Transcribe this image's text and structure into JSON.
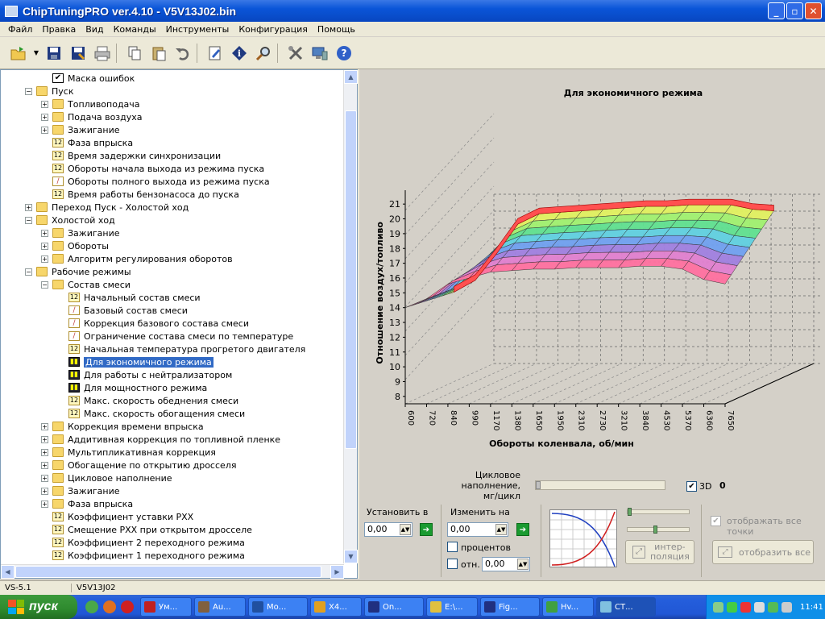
{
  "window": {
    "title": "ChipTuningPRO ver.4.10 - V5V13J02.bin"
  },
  "menu": [
    "Файл",
    "Правка",
    "Вид",
    "Команды",
    "Инструменты",
    "Конфигурация",
    "Помощь"
  ],
  "toolbar": {
    "icons": [
      "open-icon",
      "dropdown-arrow-icon",
      "save-icon",
      "save-as-icon",
      "print-icon",
      "copy-icon",
      "paste-icon",
      "undo-icon",
      "edit-icon",
      "info-icon",
      "search-icon",
      "tools-icon",
      "connect-icon",
      "help-icon"
    ]
  },
  "tree": [
    {
      "level": 2,
      "type": "check",
      "exp": "",
      "label": "Маска ошибок"
    },
    {
      "level": 1,
      "type": "folder",
      "exp": "-",
      "label": "Пуск"
    },
    {
      "level": 2,
      "type": "folder",
      "exp": "+",
      "label": "Топливоподача"
    },
    {
      "level": 2,
      "type": "folder",
      "exp": "+",
      "label": "Подача воздуха"
    },
    {
      "level": 2,
      "type": "folder",
      "exp": "+",
      "label": "Зажигание"
    },
    {
      "level": 2,
      "type": "num",
      "exp": "",
      "label": "Фаза впрыска"
    },
    {
      "level": 2,
      "type": "num",
      "exp": "",
      "label": "Время задержки синхронизации"
    },
    {
      "level": 2,
      "type": "num",
      "exp": "",
      "label": "Обороты начала выхода из режима пуска"
    },
    {
      "level": 2,
      "type": "curve",
      "exp": "",
      "label": "Обороты полного выхода из режима пуска"
    },
    {
      "level": 2,
      "type": "num",
      "exp": "",
      "label": "Время работы бензонасоса до пуска"
    },
    {
      "level": 1,
      "type": "folder",
      "exp": "+",
      "label": "Переход Пуск - Холостой ход"
    },
    {
      "level": 1,
      "type": "folder",
      "exp": "-",
      "label": "Холостой ход"
    },
    {
      "level": 2,
      "type": "folder",
      "exp": "+",
      "label": "Зажигание"
    },
    {
      "level": 2,
      "type": "folder",
      "exp": "+",
      "label": "Обороты"
    },
    {
      "level": 2,
      "type": "folder",
      "exp": "+",
      "label": "Алгоритм регулирования оборотов"
    },
    {
      "level": 1,
      "type": "folder",
      "exp": "-",
      "label": "Рабочие режимы"
    },
    {
      "level": 2,
      "type": "folder",
      "exp": "-",
      "label": "Состав смеси"
    },
    {
      "level": 3,
      "type": "num",
      "exp": "",
      "label": "Начальный состав смеси"
    },
    {
      "level": 3,
      "type": "curve",
      "exp": "",
      "label": "Базовый состав смеси"
    },
    {
      "level": 3,
      "type": "curve",
      "exp": "",
      "label": "Коррекция базового состава смеси"
    },
    {
      "level": 3,
      "type": "curve",
      "exp": "",
      "label": "Ограничение состава смеси по температуре"
    },
    {
      "level": 3,
      "type": "num",
      "exp": "",
      "label": "Начальная температура прогретого двигателя"
    },
    {
      "level": 3,
      "type": "bars",
      "exp": "",
      "label": "Для экономичного режима",
      "selected": true
    },
    {
      "level": 3,
      "type": "bars",
      "exp": "",
      "label": "Для работы с нейтрализатором"
    },
    {
      "level": 3,
      "type": "bars",
      "exp": "",
      "label": "Для мощностного режима"
    },
    {
      "level": 3,
      "type": "num",
      "exp": "",
      "label": "Макс. скорость обеднения смеси"
    },
    {
      "level": 3,
      "type": "num",
      "exp": "",
      "label": "Макс. скорость обогащения смеси"
    },
    {
      "level": 2,
      "type": "folder",
      "exp": "+",
      "label": "Коррекция времени впрыска"
    },
    {
      "level": 2,
      "type": "folder",
      "exp": "+",
      "label": "Аддитивная коррекция по топливной пленке"
    },
    {
      "level": 2,
      "type": "folder",
      "exp": "+",
      "label": "Мультипликативная коррекция"
    },
    {
      "level": 2,
      "type": "folder",
      "exp": "+",
      "label": "Обогащение по открытию дросселя"
    },
    {
      "level": 2,
      "type": "folder",
      "exp": "+",
      "label": "Цикловое наполнение"
    },
    {
      "level": 2,
      "type": "folder",
      "exp": "+",
      "label": "Зажигание"
    },
    {
      "level": 2,
      "type": "folder",
      "exp": "+",
      "label": "Фаза впрыска"
    },
    {
      "level": 2,
      "type": "num",
      "exp": "",
      "label": "Коэффициент уставки РХХ"
    },
    {
      "level": 2,
      "type": "num",
      "exp": "",
      "label": "Смещение РХХ при открытом дросселе"
    },
    {
      "level": 2,
      "type": "num",
      "exp": "",
      "label": "Коэффициент 2 переходного режима"
    },
    {
      "level": 2,
      "type": "num",
      "exp": "",
      "label": "Коэффициент 1 переходного режима"
    }
  ],
  "chart_data": {
    "type": "surface",
    "title": "Для экономичного режима",
    "ylabel": "Отношение воздух/топливо",
    "xlabel": "Обороты коленвала, об/мин",
    "yticks": [
      "8",
      "9",
      "10",
      "11",
      "12",
      "13",
      "14",
      "15",
      "16",
      "17",
      "18",
      "19",
      "20",
      "21"
    ],
    "ylim": [
      8,
      21
    ],
    "xticks": [
      "600",
      "720",
      "840",
      "990",
      "1170",
      "1380",
      "1650",
      "1950",
      "2310",
      "2730",
      "3210",
      "3840",
      "4530",
      "5370",
      "6360",
      "7650"
    ],
    "z_axis_label": "Цикловое наполнение, мг/цикл",
    "front_row": [
      14.0,
      14.6,
      15.6,
      16.0,
      16.4,
      16.5,
      16.6,
      16.6,
      16.7,
      16.7,
      16.7,
      16.8,
      16.8,
      16.6,
      15.9,
      15.6
    ],
    "back_row": [
      14.0,
      14.8,
      16.6,
      18.6,
      19.3,
      19.4,
      19.5,
      19.6,
      19.7,
      19.8,
      19.8,
      19.9,
      19.9,
      19.9,
      19.6,
      19.5
    ],
    "view": "3D",
    "grid": true
  },
  "controls": {
    "z_slider_label": "Цикловое наполнение,\nмг/цикл",
    "z_slider_level": 0,
    "check_3d_label": "3D",
    "check_3d": true,
    "zero_value": "0",
    "set_label": "Установить в",
    "set_value": "0,00",
    "change_label": "Изменить на",
    "change_value": "0,00",
    "percent_label": "процентов",
    "rel_label": "отн.",
    "rel_value": "0,00",
    "interp_label": "интер-\nполяция",
    "show_all_points_label": "отображать все точки",
    "show_all_label": "отобразить все"
  },
  "status": {
    "left": "VS-5.1",
    "file": "V5V13J02"
  },
  "taskbar": {
    "start": "пуск",
    "tasks": [
      {
        "label": "Ум...",
        "color": "#c02020"
      },
      {
        "label": "Au...",
        "color": "#806040"
      },
      {
        "label": "Мо...",
        "color": "#2050a0"
      },
      {
        "label": "Х4...",
        "color": "#e0a020"
      },
      {
        "label": "On...",
        "color": "#203080"
      },
      {
        "label": "E:\\...",
        "color": "#e0c040"
      },
      {
        "label": "Fig...",
        "color": "#203080"
      },
      {
        "label": "Hv...",
        "color": "#40a040"
      },
      {
        "label": "СТ...",
        "color": "#80c0e0",
        "active": true
      }
    ],
    "time": "11:41"
  }
}
